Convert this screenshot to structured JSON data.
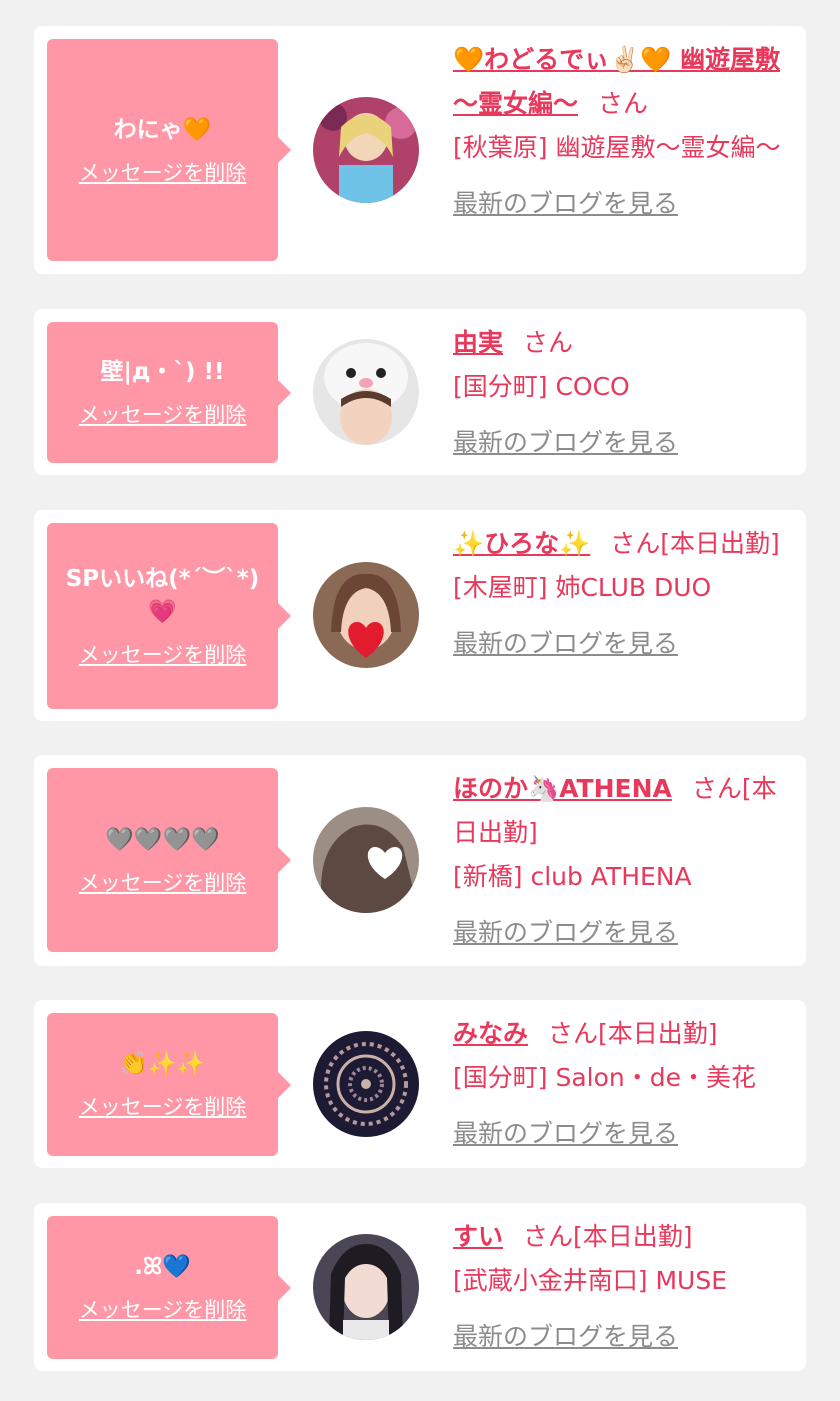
{
  "delete_label": "メッセージを削除",
  "blog_label": "最新のブログを見る",
  "colors": {
    "background": "#f1f1f1",
    "bubble": "#ff97a6",
    "accent": "#e8385c",
    "link_gray": "#8c8c8c"
  },
  "entries": [
    {
      "message": "わにゃ🧡",
      "name": "🧡わどるでぃ✌🏻🧡 幽遊屋敷～霊女編～",
      "suffix": "さん",
      "shop": "[秋葉原] 幽遊屋敷～霊女編～",
      "avatar": "avatar-photo"
    },
    {
      "message": "壁|д・`) !!",
      "name": "由実",
      "suffix": "さん",
      "shop": "[国分町] COCO",
      "avatar": "avatar-photo"
    },
    {
      "message": "SPいいね(*´︶`*)💗",
      "name": "✨ひろな✨",
      "suffix": "さん[本日出勤]",
      "shop": "[木屋町] 姉CLUB DUO",
      "avatar": "avatar-photo"
    },
    {
      "message": "🩶🩶🩶🩶",
      "name": "ほのか🦄ATHENA",
      "suffix": "さん[本日出勤]",
      "shop": "[新橋] club ATHENA",
      "avatar": "avatar-photo"
    },
    {
      "message": "👏✨✨",
      "name": "みなみ",
      "suffix": "さん[本日出勤]",
      "shop": "[国分町] Salon・de・美花",
      "avatar": "avatar-photo"
    },
    {
      "message": ".ꕤ💙",
      "name": "すい",
      "suffix": "さん[本日出勤]",
      "shop": "[武蔵小金井南口] MUSE",
      "avatar": "avatar-photo"
    }
  ]
}
